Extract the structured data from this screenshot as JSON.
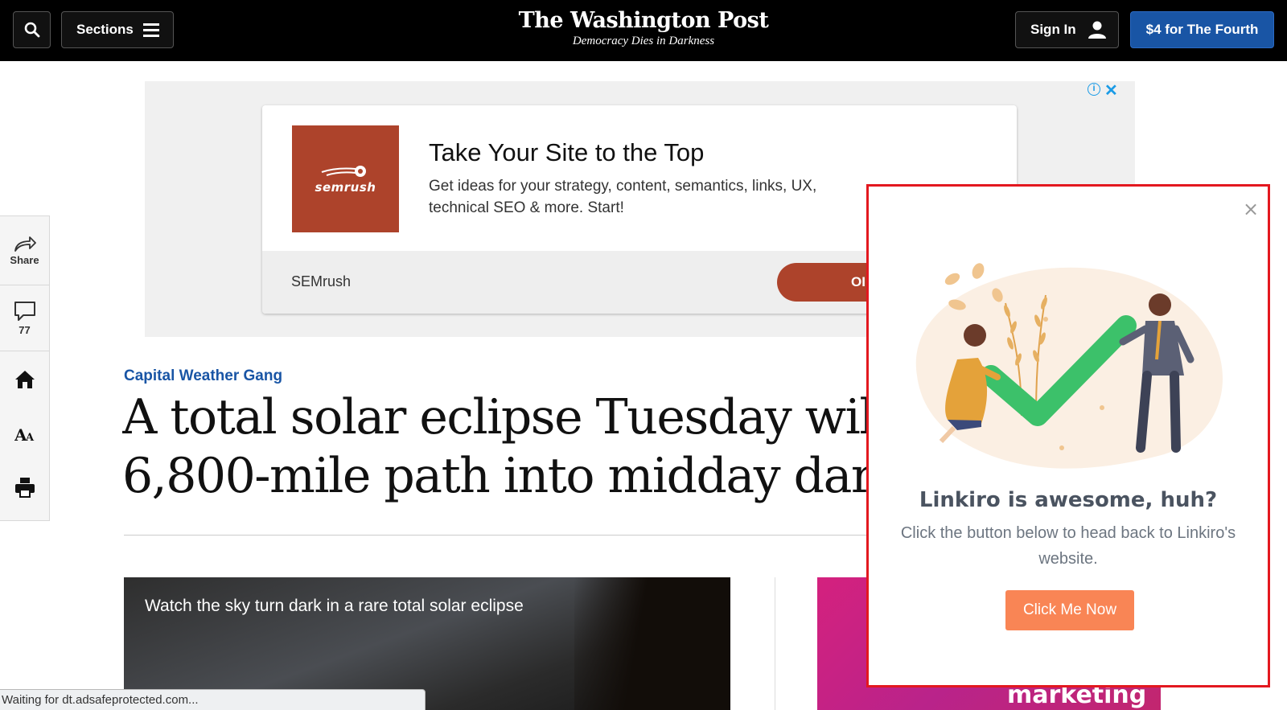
{
  "header": {
    "sections_label": "Sections",
    "logo_text": "The Washington Post",
    "tagline": "Democracy Dies in Darkness",
    "signin_label": "Sign In",
    "promo_label": "$4 for The Fourth"
  },
  "ad": {
    "brand_logo_text": "semrush",
    "headline": "Take Your Site to the Top",
    "body": "Get ideas for your strategy, content, semantics, links, UX, technical SEO & more. Start!",
    "advertiser": "SEMrush",
    "cta_partial": "OI"
  },
  "rail": {
    "share_label": "Share",
    "comments_count": "77"
  },
  "article": {
    "kicker": "Capital Weather Gang",
    "headline_line1": "A total solar eclipse Tuesday will",
    "headline_line2": "6,800-mile path into midday dar",
    "video_title": "Watch the sky turn dark in a rare total solar eclipse",
    "side_image_text": "marketing"
  },
  "status_bar": {
    "text": "Waiting for dt.adsafeprotected.com..."
  },
  "popup": {
    "close_glyph": "×",
    "title": "Linkiro is awesome, huh?",
    "body": "Click the button below to head back to Linkiro's website.",
    "button_label": "Click Me Now",
    "accent_color": "#f98555",
    "border_color": "#e3181f"
  }
}
